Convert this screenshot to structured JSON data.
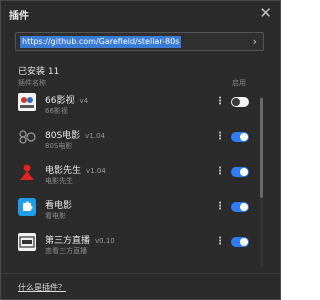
{
  "window": {
    "title": "插件",
    "close_glyph": "✕"
  },
  "url": {
    "value": "https://github.com/Garefield/stellar-80s",
    "go_glyph": "›"
  },
  "installed_label": "已安装 11",
  "headers": {
    "name": "插件名称",
    "enable": "启用"
  },
  "plugins": [
    {
      "name": "66影视",
      "version": "v4",
      "description": "66影视",
      "enabled": false
    },
    {
      "name": "80S电影",
      "version": "v1.04",
      "description": "80S电影",
      "enabled": true
    },
    {
      "name": "电影先生",
      "version": "v1.04",
      "description": "电影先生",
      "enabled": true
    },
    {
      "name": "看电影",
      "version": "",
      "description": "看电影",
      "enabled": true
    },
    {
      "name": "第三方直播",
      "version": "v0.10",
      "description": "查看三方直播",
      "enabled": true
    }
  ],
  "menu_glyph": "⋮",
  "help_link": "什么是插件？",
  "colors": {
    "accent": "#2f7cf6",
    "background": "#2b2b2b"
  },
  "icons": [
    "close-icon",
    "arrow-right-icon",
    "66ys-logo-icon",
    "80s-logo-icon",
    "red-figure-icon",
    "blue-puzzle-icon",
    "live-tv-icon",
    "more-dots-icon"
  ]
}
